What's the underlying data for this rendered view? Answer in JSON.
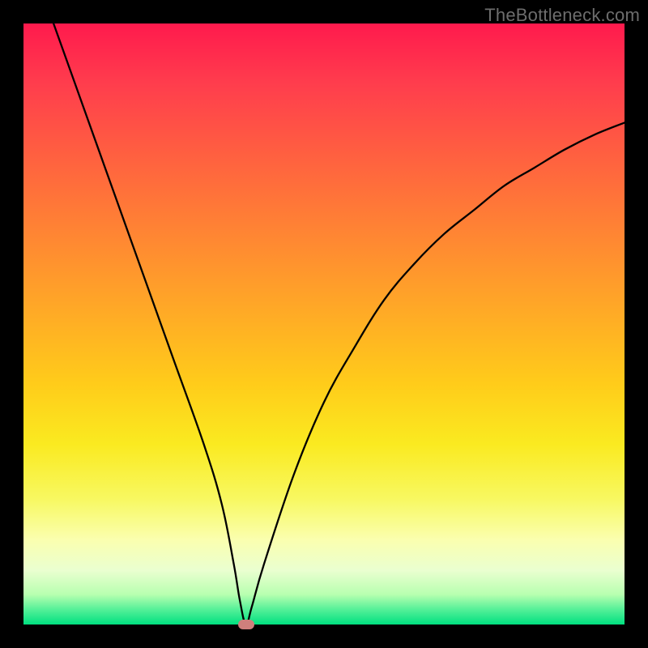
{
  "watermark": "TheBottleneck.com",
  "chart_data": {
    "type": "line",
    "title": "",
    "xlabel": "",
    "ylabel": "",
    "xlim": [
      0,
      100
    ],
    "ylim": [
      0,
      100
    ],
    "grid": false,
    "background_gradient": [
      "#ff1a4d",
      "#ff8533",
      "#ffcc1a",
      "#faffb0",
      "#00e080"
    ],
    "series": [
      {
        "name": "bottleneck-curve",
        "color": "#000000",
        "x": [
          5,
          10,
          15,
          20,
          25,
          30,
          33,
          35,
          36,
          37,
          38,
          40,
          45,
          50,
          55,
          60,
          65,
          70,
          75,
          80,
          85,
          90,
          95,
          100
        ],
        "values": [
          100,
          86,
          72,
          58,
          44,
          30,
          20,
          10,
          4,
          0,
          3,
          10,
          25,
          37,
          46,
          54,
          60,
          65,
          69,
          73,
          76,
          79,
          81.5,
          83.5
        ]
      }
    ],
    "marker": {
      "x": 37,
      "y": 0,
      "color": "#cf7f7c"
    }
  }
}
